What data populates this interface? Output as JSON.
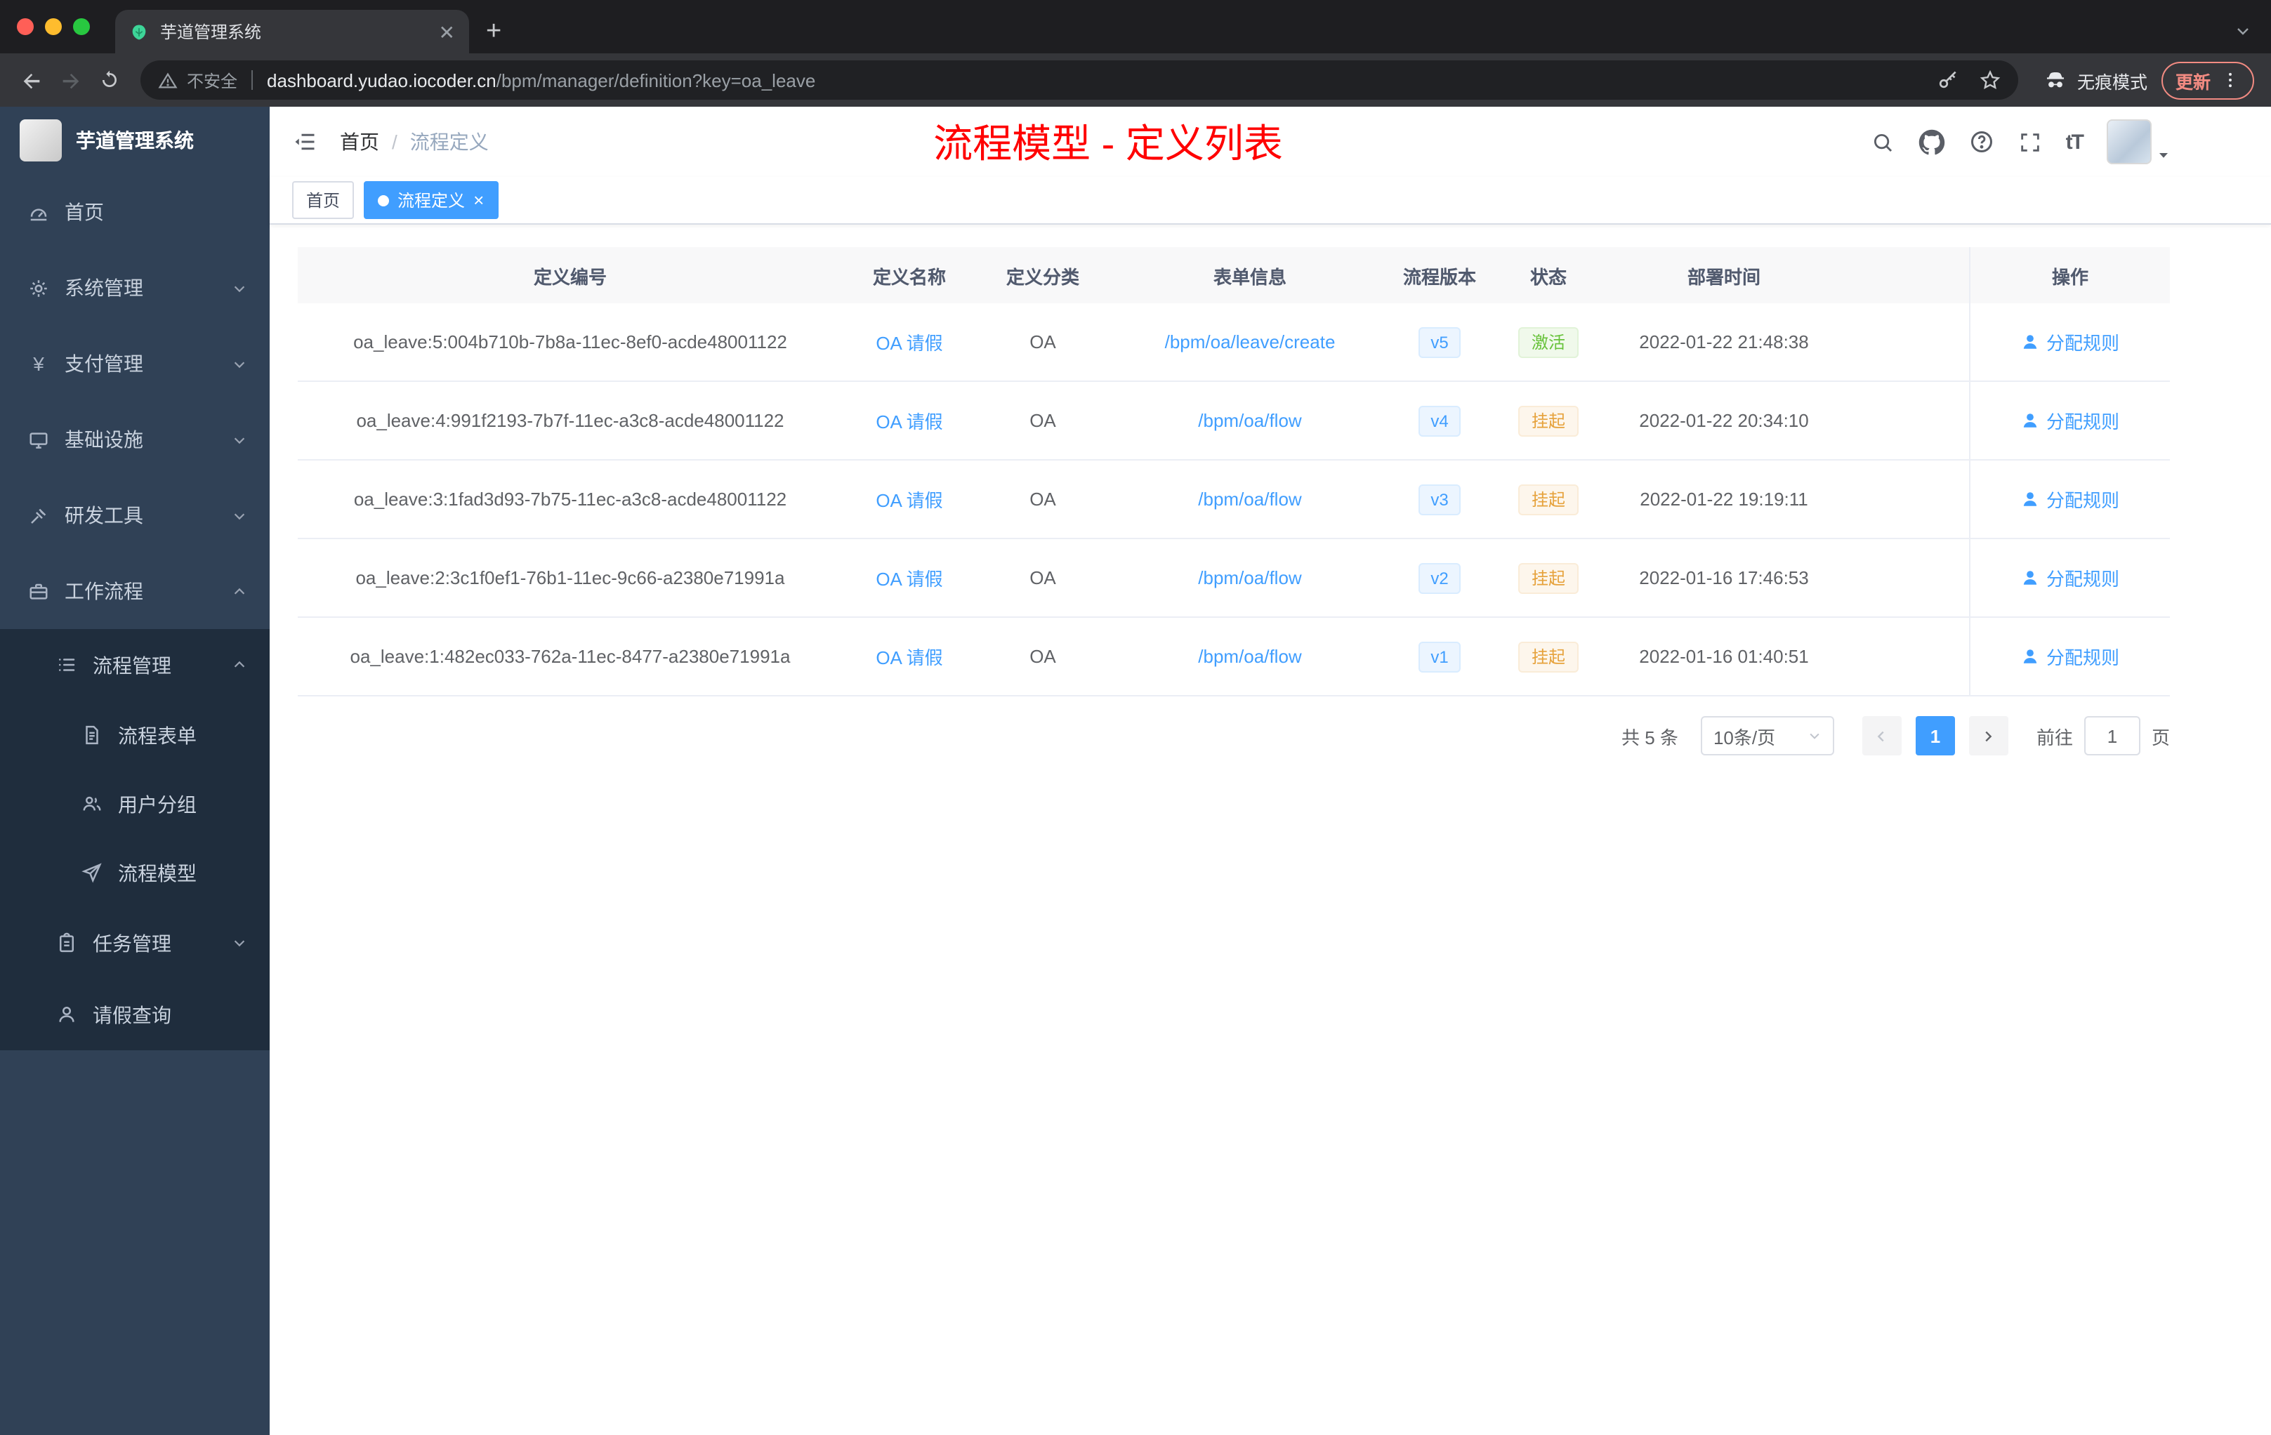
{
  "colors": {
    "accent": "#409eff",
    "success": "#67c23a",
    "warning": "#e6a23c",
    "annotation_red": "#ff0000",
    "sidebar_bg": "#304156",
    "submenu_bg": "#1f2d3d"
  },
  "browser": {
    "tab_title": "芋道管理系统",
    "security_label": "不安全",
    "url_domain": "dashboard.yudao.iocoder.cn",
    "url_path": "/bpm/manager/definition?key=oa_leave",
    "incognito_label": "无痕模式",
    "update_label": "更新"
  },
  "sidebar": {
    "brand": "芋道管理系统",
    "items": [
      {
        "label": "首页",
        "icon": "dashboard-icon"
      },
      {
        "label": "系统管理",
        "icon": "gear-icon"
      },
      {
        "label": "支付管理",
        "icon": "yen-icon"
      },
      {
        "label": "基础设施",
        "icon": "monitor-icon"
      },
      {
        "label": "研发工具",
        "icon": "tools-icon"
      },
      {
        "label": "工作流程",
        "icon": "briefcase-icon"
      },
      {
        "label": "流程管理",
        "icon": "list-icon"
      },
      {
        "label": "流程表单",
        "icon": "document-icon"
      },
      {
        "label": "用户分组",
        "icon": "users-icon"
      },
      {
        "label": "流程模型",
        "icon": "paper-plane-icon"
      },
      {
        "label": "任务管理",
        "icon": "clipboard-icon"
      },
      {
        "label": "请假查询",
        "icon": "user-icon"
      }
    ]
  },
  "header": {
    "breadcrumb_home": "首页",
    "breadcrumb_current": "流程定义",
    "annotation": "流程模型 - 定义列表",
    "font_size_icon_label": "tT"
  },
  "tags": {
    "home": "首页",
    "current": "流程定义"
  },
  "table": {
    "columns": [
      "定义编号",
      "定义名称",
      "定义分类",
      "表单信息",
      "流程版本",
      "状态",
      "部署时间",
      "操作"
    ],
    "rows": [
      {
        "id": "oa_leave:5:004b710b-7b8a-11ec-8ef0-acde48001122",
        "name": "OA 请假",
        "category": "OA",
        "form": "/bpm/oa/leave/create",
        "version": "v5",
        "status": "激活",
        "status_type": "success",
        "time": "2022-01-22 21:48:38",
        "action": "分配规则"
      },
      {
        "id": "oa_leave:4:991f2193-7b7f-11ec-a3c8-acde48001122",
        "name": "OA 请假",
        "category": "OA",
        "form": "/bpm/oa/flow",
        "version": "v4",
        "status": "挂起",
        "status_type": "warning",
        "time": "2022-01-22 20:34:10",
        "action": "分配规则"
      },
      {
        "id": "oa_leave:3:1fad3d93-7b75-11ec-a3c8-acde48001122",
        "name": "OA 请假",
        "category": "OA",
        "form": "/bpm/oa/flow",
        "version": "v3",
        "status": "挂起",
        "status_type": "warning",
        "time": "2022-01-22 19:19:11",
        "action": "分配规则"
      },
      {
        "id": "oa_leave:2:3c1f0ef1-76b1-11ec-9c66-a2380e71991a",
        "name": "OA 请假",
        "category": "OA",
        "form": "/bpm/oa/flow",
        "version": "v2",
        "status": "挂起",
        "status_type": "warning",
        "time": "2022-01-16 17:46:53",
        "action": "分配规则"
      },
      {
        "id": "oa_leave:1:482ec033-762a-11ec-8477-a2380e71991a",
        "name": "OA 请假",
        "category": "OA",
        "form": "/bpm/oa/flow",
        "version": "v1",
        "status": "挂起",
        "status_type": "warning",
        "time": "2022-01-16 01:40:51",
        "action": "分配规则"
      }
    ]
  },
  "pagination": {
    "total": "共 5 条",
    "page_size": "10条/页",
    "current_page": "1",
    "goto_label": "前往",
    "goto_value": "1",
    "page_label": "页"
  }
}
